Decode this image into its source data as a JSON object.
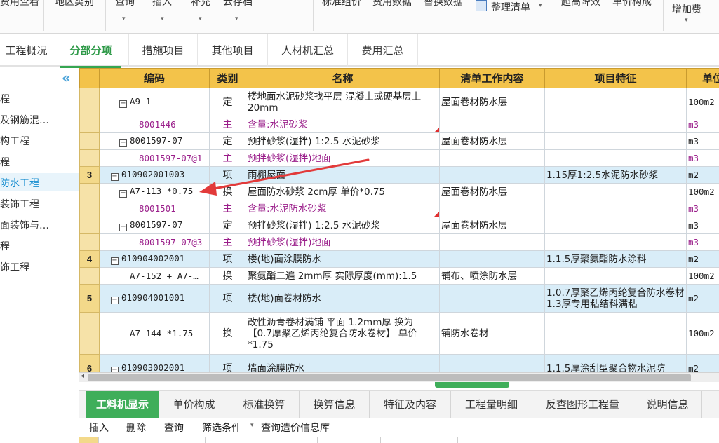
{
  "toolbar": {
    "items": [
      "费用查看",
      "地区类别",
      "查询",
      "插入",
      "补充",
      "云存档",
      "标准组价",
      "费用数据",
      "替换数据",
      "整理清单",
      "超高降效",
      "单价构成",
      "增加费"
    ]
  },
  "tabs": [
    "工程概况",
    "分部分项",
    "措施项目",
    "其他项目",
    "人材机汇总",
    "费用汇总"
  ],
  "left_tree": {
    "items": [
      "程",
      "及钢筋混…",
      "构工程",
      "程",
      "防水工程",
      "装饰工程",
      "面装饰与…",
      "程",
      "饰工程"
    ]
  },
  "grid": {
    "headers": [
      "编码",
      "类别",
      "名称",
      "清单工作内容",
      "项目特征",
      "单位"
    ],
    "rows": [
      {
        "num": "",
        "code": "A9-1",
        "type": "定",
        "name": "楼地面水泥砂浆找平层 混凝土或硬基层上 20mm",
        "work": "屋面卷材防水层",
        "feature": "",
        "unit": "100m2"
      },
      {
        "num": "",
        "code": "8001446",
        "type": "主",
        "name": "含量:水泥砂浆",
        "work": "",
        "feature": "",
        "unit": "m3"
      },
      {
        "num": "",
        "code": "8001597-07",
        "type": "定",
        "name": "预拌砂浆(湿拌) 1:2.5 水泥砂浆",
        "work": "屋面卷材防水层",
        "feature": "",
        "unit": "m3"
      },
      {
        "num": "",
        "code": "8001597-07@1",
        "type": "主",
        "name": "预拌砂浆(湿拌)地面",
        "work": "",
        "feature": "",
        "unit": "m3"
      },
      {
        "num": "3",
        "code": "010902001003",
        "type": "项",
        "name": "雨棚屋面",
        "work": "",
        "feature": "1.15厚1:2.5水泥防水砂浆",
        "unit": "m2"
      },
      {
        "num": "",
        "code": "A7-113 *0.75",
        "type": "换",
        "name": "屋面防水砂浆 2cm厚 单价*0.75",
        "work": "屋面卷材防水层",
        "feature": "",
        "unit": "100m2"
      },
      {
        "num": "",
        "code": "8001501",
        "type": "主",
        "name": "含量:水泥防水砂浆",
        "work": "",
        "feature": "",
        "unit": "m3"
      },
      {
        "num": "",
        "code": "8001597-07",
        "type": "定",
        "name": "预拌砂浆(湿拌) 1:2.5 水泥砂浆",
        "work": "屋面卷材防水层",
        "feature": "",
        "unit": "m3"
      },
      {
        "num": "",
        "code": "8001597-07@3",
        "type": "主",
        "name": "预拌砂浆(湿拌)地面",
        "work": "",
        "feature": "",
        "unit": "m3"
      },
      {
        "num": "4",
        "code": "010904002001",
        "type": "项",
        "name": "楼(地)面涂膜防水",
        "work": "",
        "feature": "1.1.5厚聚氨酯防水涂料",
        "unit": "m2"
      },
      {
        "num": "",
        "code": "A7-152 + A7-…",
        "type": "换",
        "name": "聚氨酯二遍 2mm厚 实际厚度(mm):1.5",
        "work": "铺布、喷涂防水层",
        "feature": "",
        "unit": "100m2"
      },
      {
        "num": "5",
        "code": "010904001001",
        "type": "项",
        "name": "楼(地)面卷材防水",
        "work": "",
        "feature": "1.0.7厚聚乙烯丙纶复合防水卷材1.3厚专用粘结料满粘",
        "unit": "m2"
      },
      {
        "num": "",
        "code": "A7-144 *1.75",
        "type": "换",
        "name": "改性沥青卷材满铺 平面 1.2mm厚 换为【0.7厚聚乙烯丙纶复合防水卷材】 单价*1.75",
        "work": "铺防水卷材",
        "feature": "",
        "unit": "100m2"
      },
      {
        "num": "6",
        "code": "010903002001",
        "type": "项",
        "name": "墙面涂膜防水",
        "work": "",
        "feature": "1.1.5厚涂刮型聚合物水泥防",
        "unit": "m2"
      }
    ]
  },
  "bottom_tabs": [
    "工料机显示",
    "单价构成",
    "标准换算",
    "换算信息",
    "特征及内容",
    "工程量明细",
    "反查图形工程量",
    "说明信息"
  ],
  "bottom_tools": [
    "插入",
    "删除",
    "查询",
    "筛选条件",
    "查询造价信息库"
  ],
  "colors": {
    "header": "#f3c34a",
    "bill_row": "#d9edf8",
    "accent_green": "#3fae5a",
    "sub_text": "#9a1e8a",
    "annotation_arrow": "#e23a3a"
  }
}
